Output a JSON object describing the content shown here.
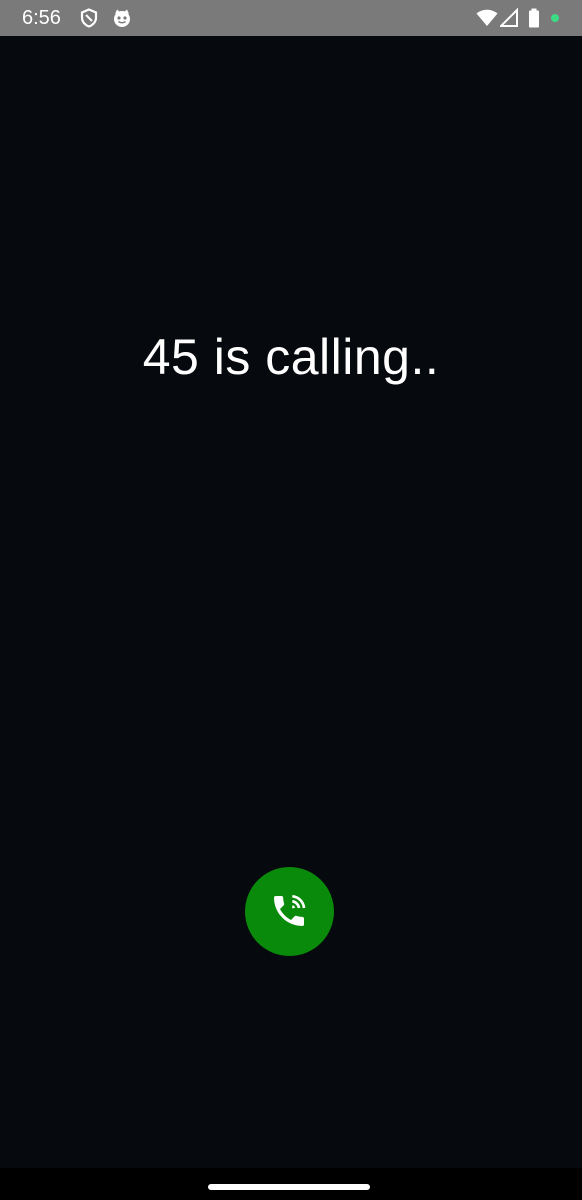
{
  "status_bar": {
    "time": "6:56",
    "icons": [
      "shield-icon",
      "cat-notification-icon",
      "wifi-icon",
      "cellular-signal-icon",
      "battery-icon",
      "privacy-dot-icon"
    ],
    "background": "#7a7a7a",
    "privacy_dot_color": "#3ddc84"
  },
  "call": {
    "caller_text": "45 is calling..",
    "text_color": "#ffffff",
    "background": "#060a0e"
  },
  "answer_button": {
    "icon": "phone-ringing-icon",
    "color": "#0a8a0a"
  },
  "navigation": {
    "handle": "home-gesture-handle"
  }
}
